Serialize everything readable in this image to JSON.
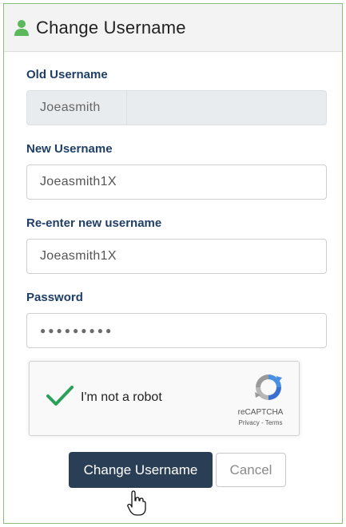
{
  "header": {
    "title": "Change Username",
    "icon": "user-icon",
    "icon_color": "#5cb85c"
  },
  "form": {
    "old_username": {
      "label": "Old Username",
      "value": "Joeasmith"
    },
    "new_username": {
      "label": "New Username",
      "value": "Joeasmith1X"
    },
    "confirm_username": {
      "label": "Re-enter new username",
      "value": "Joeasmith1X"
    },
    "password": {
      "label": "Password",
      "masked_value": "●●●●●●●●●"
    }
  },
  "captcha": {
    "label": "I'm not a robot",
    "brand": "reCAPTCHA",
    "links": "Privacy - Terms",
    "checked": true
  },
  "actions": {
    "submit_label": "Change Username",
    "cancel_label": "Cancel"
  },
  "colors": {
    "label": "#1f3f66",
    "primary_button": "#2a3f55",
    "check": "#2aa05a",
    "panel_border": "#8bbf7a"
  }
}
